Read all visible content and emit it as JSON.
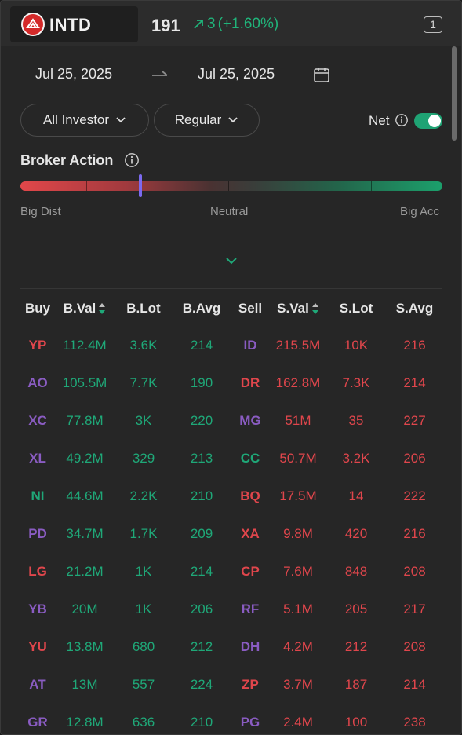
{
  "header": {
    "ticker": "INTD",
    "price": "191",
    "change": "3",
    "change_pct": "(+1.60%)",
    "badge": "1",
    "logo_icon": "intd-logo-icon"
  },
  "date_range": {
    "from": "Jul 25, 2025",
    "to": "Jul 25, 2025"
  },
  "filters": {
    "investor": "All Investor",
    "market": "Regular",
    "net_label": "Net",
    "net_enabled": true
  },
  "broker_action": {
    "title": "Broker Action",
    "left_label": "Big Dist",
    "mid_label": "Neutral",
    "right_label": "Big Acc",
    "level_fraction": 0.285,
    "gradient_colors": [
      "#e2474a",
      "#1ca06c"
    ]
  },
  "table": {
    "headers": {
      "buy": "Buy",
      "bval": "B.Val",
      "blot": "B.Lot",
      "bavg": "B.Avg",
      "sell": "Sell",
      "sval": "S.Val",
      "slot": "S.Lot",
      "savg": "S.Avg"
    },
    "rows": [
      {
        "buy": "YP",
        "buy_color": "red",
        "bval": "112.4M",
        "blot": "3.6K",
        "bavg": "214",
        "sell": "ID",
        "sell_color": "purple",
        "sval": "215.5M",
        "slot": "10K",
        "savg": "216"
      },
      {
        "buy": "AO",
        "buy_color": "purple",
        "bval": "105.5M",
        "blot": "7.7K",
        "bavg": "190",
        "sell": "DR",
        "sell_color": "red",
        "sval": "162.8M",
        "slot": "7.3K",
        "savg": "214"
      },
      {
        "buy": "XC",
        "buy_color": "purple",
        "bval": "77.8M",
        "blot": "3K",
        "bavg": "220",
        "sell": "MG",
        "sell_color": "purple",
        "sval": "51M",
        "slot": "35",
        "savg": "227"
      },
      {
        "buy": "XL",
        "buy_color": "purple",
        "bval": "49.2M",
        "blot": "329",
        "bavg": "213",
        "sell": "CC",
        "sell_color": "green",
        "sval": "50.7M",
        "slot": "3.2K",
        "savg": "206"
      },
      {
        "buy": "NI",
        "buy_color": "green",
        "bval": "44.6M",
        "blot": "2.2K",
        "bavg": "210",
        "sell": "BQ",
        "sell_color": "red",
        "sval": "17.5M",
        "slot": "14",
        "savg": "222"
      },
      {
        "buy": "PD",
        "buy_color": "purple",
        "bval": "34.7M",
        "blot": "1.7K",
        "bavg": "209",
        "sell": "XA",
        "sell_color": "red",
        "sval": "9.8M",
        "slot": "420",
        "savg": "216"
      },
      {
        "buy": "LG",
        "buy_color": "red",
        "bval": "21.2M",
        "blot": "1K",
        "bavg": "214",
        "sell": "CP",
        "sell_color": "red",
        "sval": "7.6M",
        "slot": "848",
        "savg": "208"
      },
      {
        "buy": "YB",
        "buy_color": "purple",
        "bval": "20M",
        "blot": "1K",
        "bavg": "206",
        "sell": "RF",
        "sell_color": "purple",
        "sval": "5.1M",
        "slot": "205",
        "savg": "217"
      },
      {
        "buy": "YU",
        "buy_color": "red",
        "bval": "13.8M",
        "blot": "680",
        "bavg": "212",
        "sell": "DH",
        "sell_color": "purple",
        "sval": "4.2M",
        "slot": "212",
        "savg": "208"
      },
      {
        "buy": "AT",
        "buy_color": "purple",
        "bval": "13M",
        "blot": "557",
        "bavg": "224",
        "sell": "ZP",
        "sell_color": "red",
        "sval": "3.7M",
        "slot": "187",
        "savg": "214"
      },
      {
        "buy": "GR",
        "buy_color": "purple",
        "bval": "12.8M",
        "blot": "636",
        "bavg": "210",
        "sell": "PG",
        "sell_color": "purple",
        "sval": "2.4M",
        "slot": "100",
        "savg": "238"
      }
    ]
  },
  "colors": {
    "up": "#1fa878",
    "down": "#e0464c",
    "broker_purple": "#8a5cc2",
    "marker": "#7c6af0",
    "toggle_on": "#1fa374"
  }
}
